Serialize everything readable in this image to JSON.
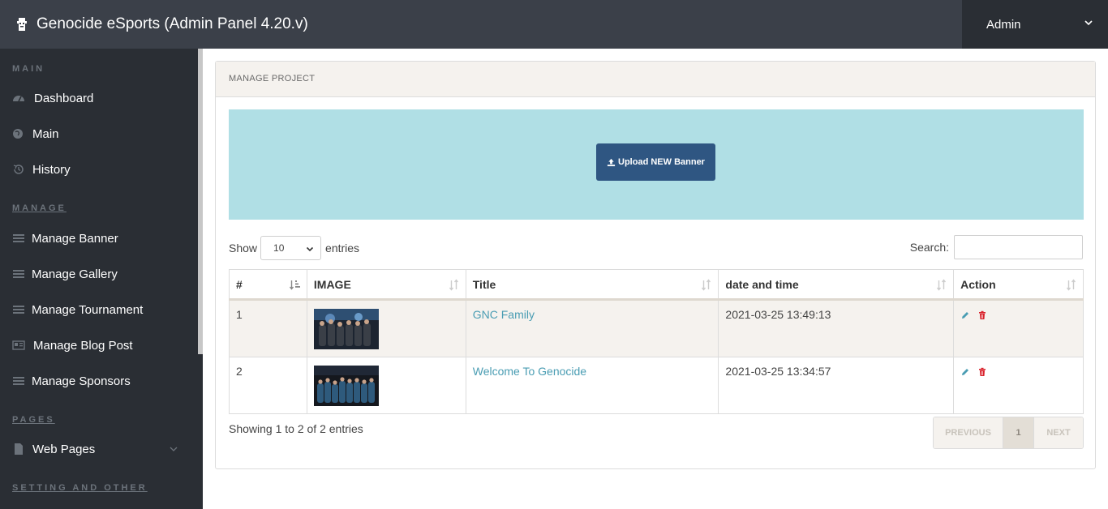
{
  "header": {
    "app_title": "Genocide eSports (Admin Panel 4.20.v)",
    "user_menu_label": "Admin"
  },
  "sidebar": {
    "sections": [
      {
        "label": "MAIN",
        "items": [
          {
            "label": "Dashboard",
            "icon": "dashboard-icon"
          },
          {
            "label": "Main",
            "icon": "globe-icon"
          },
          {
            "label": "History",
            "icon": "history-icon"
          }
        ]
      },
      {
        "label": "MANAGE",
        "items": [
          {
            "label": "Manage Banner",
            "icon": "list-icon"
          },
          {
            "label": "Manage Gallery",
            "icon": "list-icon"
          },
          {
            "label": "Manage Tournament",
            "icon": "list-icon"
          },
          {
            "label": "Manage Blog Post",
            "icon": "newspaper-icon"
          },
          {
            "label": "Manage Sponsors",
            "icon": "list-icon"
          }
        ]
      },
      {
        "label": "PAGES",
        "items": [
          {
            "label": "Web Pages",
            "icon": "file-icon"
          }
        ]
      },
      {
        "label": "SETTING AND OTHER",
        "items": []
      }
    ]
  },
  "panel": {
    "title": "MANAGE PROJECT",
    "upload_button_label": "Upload NEW Banner",
    "length": {
      "prefix": "Show",
      "value": "10",
      "suffix": "entries"
    },
    "search": {
      "label": "Search:",
      "value": ""
    }
  },
  "table": {
    "columns": [
      "#",
      "IMAGE",
      "Title",
      "date and time",
      "Action"
    ],
    "rows": [
      {
        "num": "1",
        "image": "group-photo-thumbnail",
        "title": "GNC Family",
        "datetime": "2021-03-25 13:49:13"
      },
      {
        "num": "2",
        "image": "group-photo-thumbnail",
        "title": "Welcome To Genocide",
        "datetime": "2021-03-25 13:34:57"
      }
    ]
  },
  "footer": {
    "info": "Showing 1 to 2 of 2 entries",
    "pagination": {
      "previous": "PREVIOUS",
      "current_page": "1",
      "next": "NEXT"
    }
  },
  "colors": {
    "topbar": "#3b4049",
    "sidebar": "#2a2e34",
    "banner_box": "#b0dfe5",
    "upload_button": "#2f5682",
    "link": "#4a9db3",
    "edit_icon": "#4a9db3",
    "delete_icon": "#d9232d"
  }
}
